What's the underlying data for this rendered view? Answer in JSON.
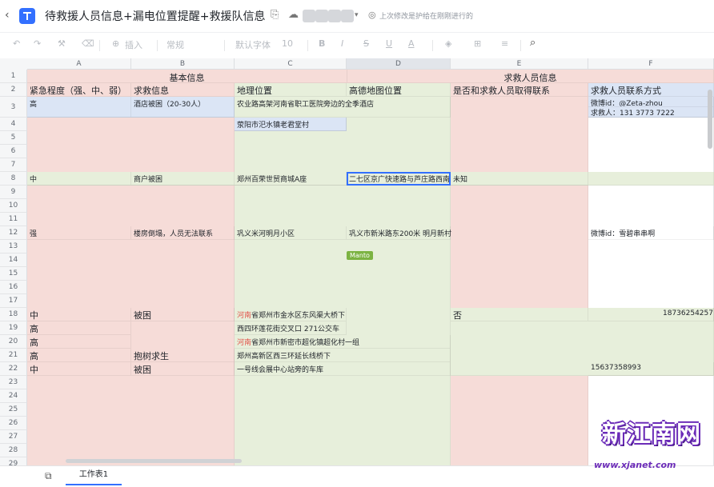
{
  "header": {
    "title": "待救援人员信息+漏电位置提醒+救援队信息",
    "status": "上次修改是护给在刚刚进行的"
  },
  "icons": {
    "back": "chevron-left-icon",
    "doc": "sheet-doc-icon",
    "star": "star-icon",
    "share": "share-icon",
    "cloud": "cloud-icon",
    "collaborators": "avatar-icon",
    "more": "chevron-down-icon",
    "saved": "check-circle-icon"
  },
  "toolbar": {
    "insert": "插入",
    "font_size_label": "常规",
    "font": "默认字体",
    "font_size": "10"
  },
  "columns": [
    "A",
    "B",
    "C",
    "D",
    "E",
    "F"
  ],
  "rows": [
    "1",
    "2",
    "3",
    "4",
    "5",
    "6",
    "7",
    "8",
    "9",
    "10",
    "11",
    "12",
    "13",
    "14",
    "15",
    "16",
    "17",
    "18",
    "19",
    "20",
    "21",
    "22",
    "23",
    "24",
    "25",
    "26",
    "27",
    "28",
    "29"
  ],
  "cells": {
    "r1_basic": "基本信息",
    "r1_rescuer": "求救人员信息",
    "h_level": "紧急程度（强、中、弱）",
    "h_info": "求救信息",
    "h_geo": "地理位置",
    "h_amap": "高德地图位置",
    "h_contacted": "是否和求救人员取得联系",
    "h_contact": "求救人员联系方式",
    "r3_a": "高",
    "r3_b": "酒店被困（20-30人）",
    "r3_c": "农业路高架河南省职工医院旁边的全季酒店",
    "r3_f1": "微博id：@Zeta-zhou",
    "r3_f2": "求救人：131 3773 7222",
    "r4_c": "荥阳市汜水镇老君堂村",
    "r8_a": "中",
    "r8_b": "商户被困",
    "r8_c": "郑州百荣世贸商城A座",
    "r8_d": "二七区京广快速路与芦庄路西南",
    "r8_e": "未知",
    "r12_a": "强",
    "r12_b": "楼房倒塌，人员无法联系",
    "r12_c": "巩义米河明月小区",
    "r12_d": "巩义市新米路东200米 明月新村",
    "r12_f": "微博id：雪碧串串啊",
    "r18_a": "中",
    "r18_b": "被困",
    "r18_c_red": "河南",
    "r18_c": "省郑州市金水区东风渠大桥下",
    "r18_e": "否",
    "r18_f": "18736254257",
    "r19_a": "高",
    "r19_c": "西四环莲花街交叉口 271公交车",
    "r20_a": "高",
    "r20_c_red": "河南",
    "r20_c": "省郑州市新密市超化镇超化村一组",
    "r21_a": "高",
    "r21_b": "抱树求生",
    "r21_c": "郑州高新区西三环延长线桥下",
    "r22_a": "中",
    "r22_b": "被困",
    "r22_c": "一号线会展中心站旁的车库",
    "r22_f": "15637358993"
  },
  "collab_label": "Manto",
  "sheet_tab": "工作表1",
  "watermark": {
    "text": "新江南网",
    "url": "www.xjanet.com"
  }
}
